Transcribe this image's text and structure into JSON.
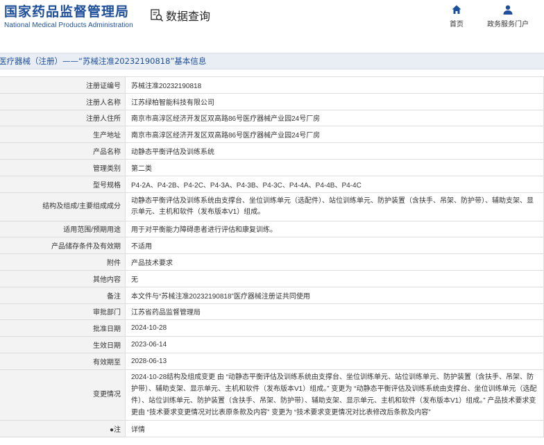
{
  "header": {
    "brand_cn": "国家药品监督管理局",
    "brand_en": "National Medical Products Administration",
    "query_label": "数据查询",
    "nav": [
      {
        "label": "首页",
        "icon": "home-icon"
      },
      {
        "label": "政务服务门户",
        "icon": "user-icon"
      }
    ]
  },
  "title": "医疗器械（注册）——“苏械注准20232190818”基本信息",
  "rows": [
    {
      "label": "注册证编号",
      "value": "苏械注准20232190818"
    },
    {
      "label": "注册人名称",
      "value": "江苏绿柏智能科技有限公司"
    },
    {
      "label": "注册人住所",
      "value": "南京市高淳区经济开发区双高路86号医疗器械产业园24号厂房"
    },
    {
      "label": "生产地址",
      "value": "南京市高淳区经济开发区双高路86号医疗器械产业园24号厂房"
    },
    {
      "label": "产品名称",
      "value": "动静态平衡评估及训练系统"
    },
    {
      "label": "管理类别",
      "value": "第二类"
    },
    {
      "label": "型号规格",
      "value": "P4-2A、P4-2B、P4-2C、P4-3A、P4-3B、P4-3C、P4-4A、P4-4B、P4-4C"
    },
    {
      "label": "结构及组成/主要组成成分",
      "value": "动静态平衡评估及训练系统由支撑台、坐位训练单元（选配件）、站位训练单元、防护装置（含扶手、吊架、防护带）、辅助支架、显示单元、主机和软件（发布版本V1）组成。"
    },
    {
      "label": "适用范围/预期用途",
      "value": "用于对平衡能力障碍患者进行评估和康复训练。"
    },
    {
      "label": "产品储存条件及有效期",
      "value": "不适用"
    },
    {
      "label": "附件",
      "value": "产品技术要求"
    },
    {
      "label": "其他内容",
      "value": "无"
    },
    {
      "label": "备注",
      "value": "本文件与“苏械注准20232190818”医疗器械注册证共同使用"
    },
    {
      "label": "审批部门",
      "value": "江苏省药品监督管理局"
    },
    {
      "label": "批准日期",
      "value": "2024-10-28"
    },
    {
      "label": "生效日期",
      "value": "2023-06-14"
    },
    {
      "label": "有效期至",
      "value": "2028-06-13"
    },
    {
      "label": "变更情况",
      "value": "2024-10-28结构及组成变更 由 “动静态平衡评估及训练系统由支撑台、坐位训练单元、站位训练单元、防护装置（含扶手、吊架、防护带）、辅助支架、显示单元、主机和软件（发布版本V1）组成。” 变更为 “动静态平衡评估及训练系统由支撑台、坐位训练单元（选配件）、站位训练单元、防护装置（含扶手、吊架、防护带）、辅助支架、显示单元、主机和软件（发布版本V1）组成。” 产品技术要求变更由 “技术要求变更情况对比表原条款及内容” 变更为 “技术要求变更情况对比表修改后条款及内容”"
    },
    {
      "label": "注",
      "value": "详情"
    }
  ]
}
